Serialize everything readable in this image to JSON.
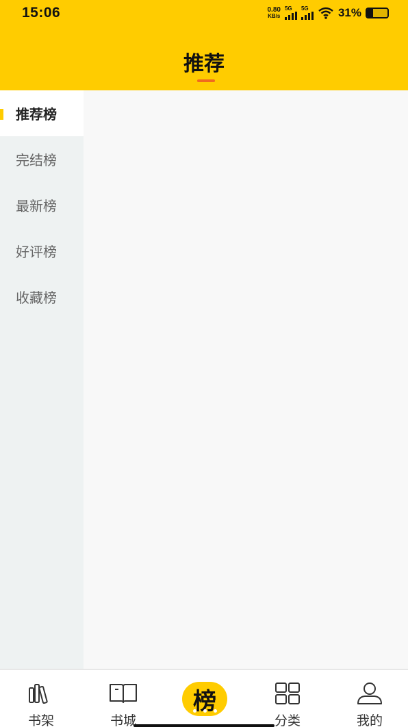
{
  "status": {
    "time": "15:06",
    "net_speed_value": "0.80",
    "net_speed_unit": "KB/s",
    "signal1_label": "5G",
    "signal2_label": "5G",
    "battery_percent": "31%",
    "battery_level": 0.31
  },
  "header": {
    "title": "推荐",
    "background_color": "#ffcc00",
    "underline_color": "#f06a1f"
  },
  "sidebar": {
    "items": [
      {
        "label": "推荐榜",
        "active": true
      },
      {
        "label": "完结榜",
        "active": false
      },
      {
        "label": "最新榜",
        "active": false
      },
      {
        "label": "好评榜",
        "active": false
      },
      {
        "label": "收藏榜",
        "active": false
      }
    ]
  },
  "tabbar": {
    "items": [
      {
        "label": "书架",
        "icon": "bookshelf-icon"
      },
      {
        "label": "书城",
        "icon": "open-book-icon"
      },
      {
        "label": "榜",
        "icon": "ranking-badge",
        "active": true
      },
      {
        "label": "分类",
        "icon": "grid-icon"
      },
      {
        "label": "我的",
        "icon": "user-icon"
      }
    ]
  }
}
